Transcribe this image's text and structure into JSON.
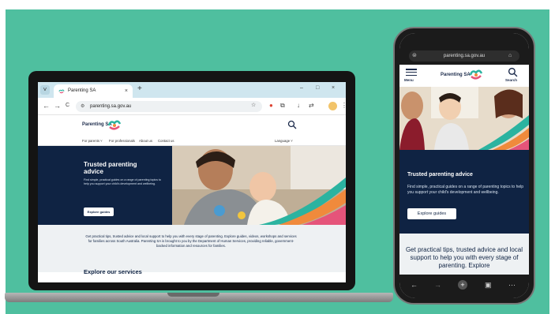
{
  "colors": {
    "stage": "#4fbf9f",
    "navy": "#0f2343",
    "brand_teal": "#2bb3a0",
    "brand_orange": "#f08a3c",
    "brand_pink": "#e5547a"
  },
  "laptop": {
    "tab": {
      "title": "Parenting SA",
      "close": "×"
    },
    "new_tab": "+",
    "window_controls": [
      "–",
      "□",
      "×"
    ],
    "toolbar": {
      "back": "←",
      "forward": "→",
      "reload": "C"
    },
    "url": "parenting.sa.gov.au",
    "site": {
      "logo": "Parenting SA",
      "nav": [
        "For parents ˅",
        "For professionals",
        "About us",
        "Contact us"
      ],
      "language": "Language ˅",
      "hero": {
        "title": "Trusted parenting advice",
        "description": "Find simple, practical guides on a range of parenting topics to help you support your child's development and wellbeing.",
        "button": "Explore guides"
      },
      "intro": "Get practical tips, trusted advice and local support to help you with every stage of parenting. Explore guides, videos, workshops and services for families across South Australia. Parenting SA is brought to you by the Department of Human Services, providing reliable, government-backed information and resources for families.",
      "section_heading": "Explore our services"
    }
  },
  "phone": {
    "url": "parenting.sa.gov.au",
    "menu_label": "Menu",
    "logo": "Parenting SA",
    "search_label": "Search",
    "hero": {
      "title": "Trusted parenting advice",
      "description": "Find simple, practical guides on a range of parenting topics to help you support your child's development and wellbeing.",
      "button": "Explore guides"
    },
    "intro": "Get practical tips, trusted advice and local support to help you with every stage of parenting. Explore",
    "bottom_bar": [
      "←",
      "→",
      "+",
      "▣",
      "⋯"
    ]
  }
}
